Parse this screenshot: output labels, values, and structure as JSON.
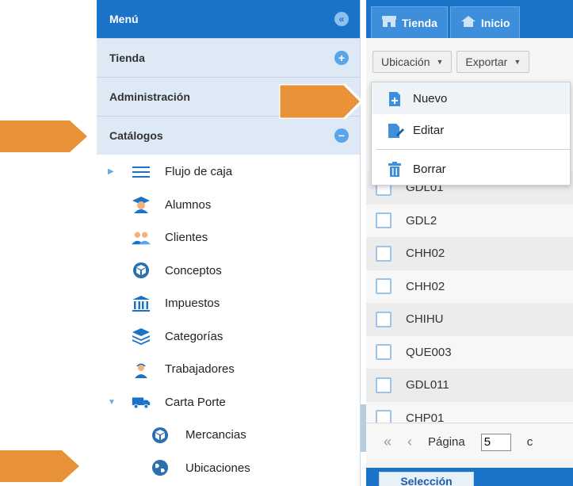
{
  "sidebar": {
    "header": "Menú",
    "sections": [
      {
        "label": "Tienda"
      },
      {
        "label": "Administración"
      },
      {
        "label": "Catálogos"
      }
    ],
    "tree": [
      {
        "label": "Flujo de caja",
        "icon": "list-icon"
      },
      {
        "label": "Alumnos",
        "icon": "graduate-icon"
      },
      {
        "label": "Clientes",
        "icon": "users-icon"
      },
      {
        "label": "Conceptos",
        "icon": "box-icon"
      },
      {
        "label": "Impuestos",
        "icon": "bank-icon"
      },
      {
        "label": "Categorías",
        "icon": "layers-icon"
      },
      {
        "label": "Trabajadores",
        "icon": "worker-icon"
      },
      {
        "label": "Carta Porte",
        "icon": "truck-icon"
      },
      {
        "label": "Mercancias",
        "icon": "box-icon"
      },
      {
        "label": "Ubicaciones",
        "icon": "globe-icon"
      }
    ]
  },
  "tabs": [
    {
      "label": "Tienda",
      "icon": "store-icon"
    },
    {
      "label": "Inicio",
      "icon": "home-icon"
    }
  ],
  "toolbar": {
    "location_label": "Ubicación",
    "export_label": "Exportar"
  },
  "dropdown": {
    "items": [
      {
        "label": "Nuevo",
        "icon": "new-file-icon"
      },
      {
        "label": "Editar",
        "icon": "edit-file-icon"
      },
      {
        "label": "Borrar",
        "icon": "trash-icon"
      }
    ]
  },
  "rows": [
    {
      "code": "GDL01"
    },
    {
      "code": "GDL2"
    },
    {
      "code": "CHH02"
    },
    {
      "code": "CHH02"
    },
    {
      "code": "CHIHU"
    },
    {
      "code": "QUE003"
    },
    {
      "code": "GDL011"
    },
    {
      "code": "CHP01"
    }
  ],
  "pager": {
    "label": "Página",
    "value": "5",
    "trailing": "c"
  },
  "bottom": {
    "tab_label": "Selección"
  },
  "colors": {
    "primary": "#1a73c8",
    "arrow": "#e8923a",
    "section_bg": "#dde9f5"
  }
}
